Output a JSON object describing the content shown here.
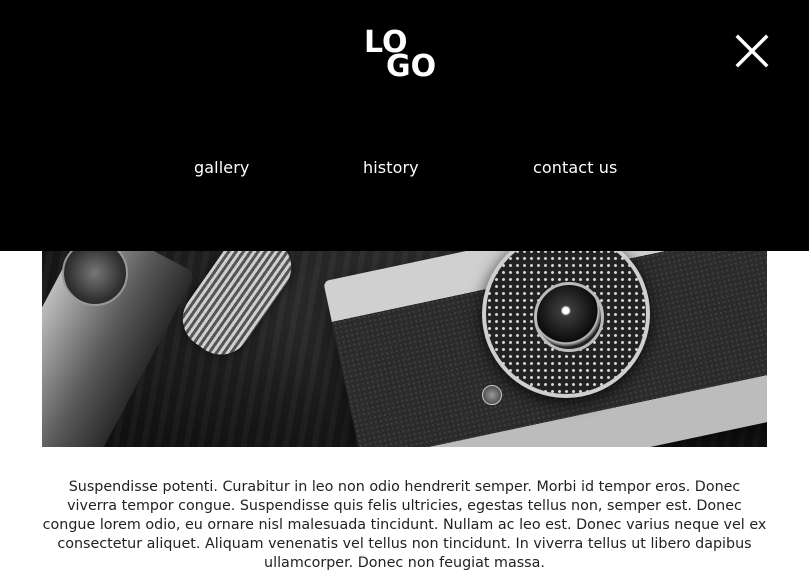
{
  "header": {
    "logo_text_line1": "LO",
    "logo_text_line2": "GO",
    "close_icon": "close-icon"
  },
  "nav": {
    "items": [
      {
        "label": "gallery"
      },
      {
        "label": "history"
      },
      {
        "label": "contact us"
      }
    ]
  },
  "hero": {
    "image": "camera-photo"
  },
  "content": {
    "paragraph": "Suspendisse potenti. Curabitur in leo non odio hendrerit semper. Morbi id tempor eros. Donec viverra tempor congue. Suspendisse quis felis ultricies, egestas tellus non, semper est. Donec congue lorem odio, eu ornare nisl malesuada tincidunt. Nullam ac leo est. Donec varius neque vel ex consectetur aliquet. Aliquam venenatis vel tellus non tincidunt. In viverra tellus ut libero dapibus ullamcorper. Donec non feugiat massa."
  },
  "colors": {
    "header_bg": "#000000",
    "nav_text": "#ffffff",
    "body_text": "#222222",
    "page_bg": "#ffffff"
  }
}
